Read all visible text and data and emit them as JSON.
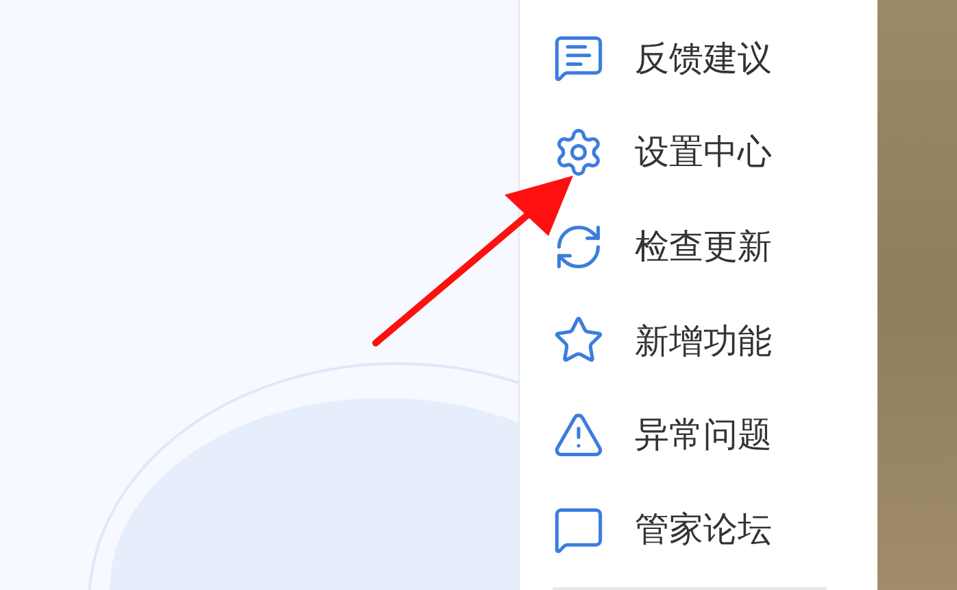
{
  "menu": {
    "items": [
      {
        "kind": "feedback",
        "label": "反馈建议"
      },
      {
        "kind": "settings",
        "label": "设置中心"
      },
      {
        "kind": "update",
        "label": "检查更新"
      },
      {
        "kind": "new",
        "label": "新增功能"
      },
      {
        "kind": "warning",
        "label": "异常问题"
      },
      {
        "kind": "forum",
        "label": "管家论坛"
      }
    ]
  }
}
